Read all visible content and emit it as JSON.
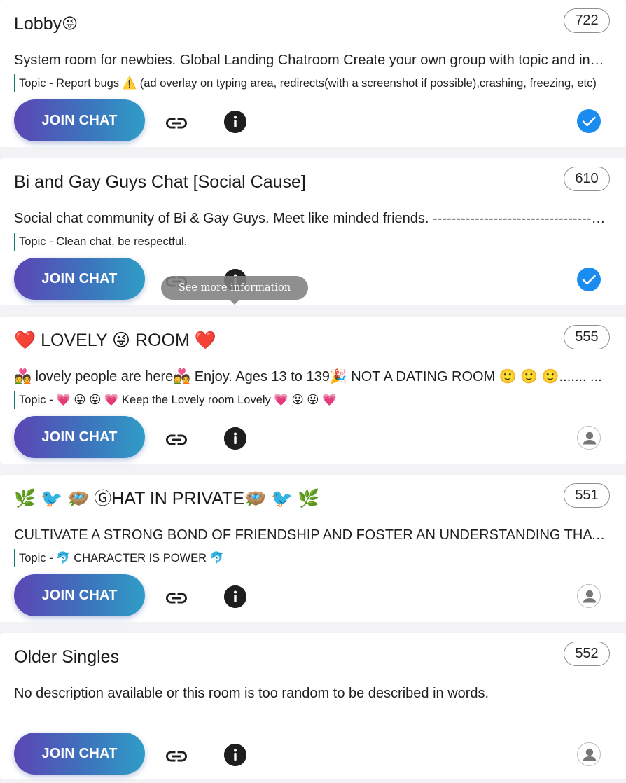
{
  "tooltip": {
    "text": "See more information"
  },
  "buttons": {
    "join_label": "JOIN CHAT"
  },
  "rooms": [
    {
      "title": "Lobby",
      "title_emoji": "😜",
      "count": "722",
      "description": "System room for newbies. Global Landing Chatroom Create your own group with topic and invite your friends to chat",
      "topic": "Topic - Report bugs ⚠️ (ad overlay on typing area, redirects(with a screenshot if possible),crashing, freezing, etc)",
      "status": "verified"
    },
    {
      "title": "Bi and Gay Guys Chat [Social Cause]",
      "title_emoji": "",
      "count": "610",
      "description": "Social chat community of Bi & Gay Guys. Meet like minded friends. ---------------------------------------",
      "topic": "Topic - Clean chat, be respectful.",
      "status": "verified"
    },
    {
      "title": "❤️ LOVELY 😜 ROOM ❤️",
      "title_emoji": "",
      "count": "555",
      "description": "💑 lovely people are here💑 Enjoy. Ages 13 to 139🎉  NOT A DATING ROOM 🙂 🙂 🙂....... ...",
      "topic": "Topic -  💗 😛 😛  💗  Keep the Lovely room Lovely  💗  😛 😛 💗",
      "status": "avatar"
    },
    {
      "title": "🌿 🐦 🪺 ⒼHAT IN PRIVATE🪺 🐦 🌿",
      "title_emoji": "",
      "count": "551",
      "description": "CULTIVATE A STRONG BOND OF FRIENDSHIP AND FOSTER AN UNDERSTANDING THAT ENDURES",
      "topic": "Topic -  🐬 CHARACTER IS POWER  🐬",
      "status": "avatar"
    },
    {
      "title": "Older Singles",
      "title_emoji": "",
      "count": "552",
      "description": "No description available or this room is too random to be described in words.",
      "topic": "",
      "status": "avatar"
    }
  ]
}
